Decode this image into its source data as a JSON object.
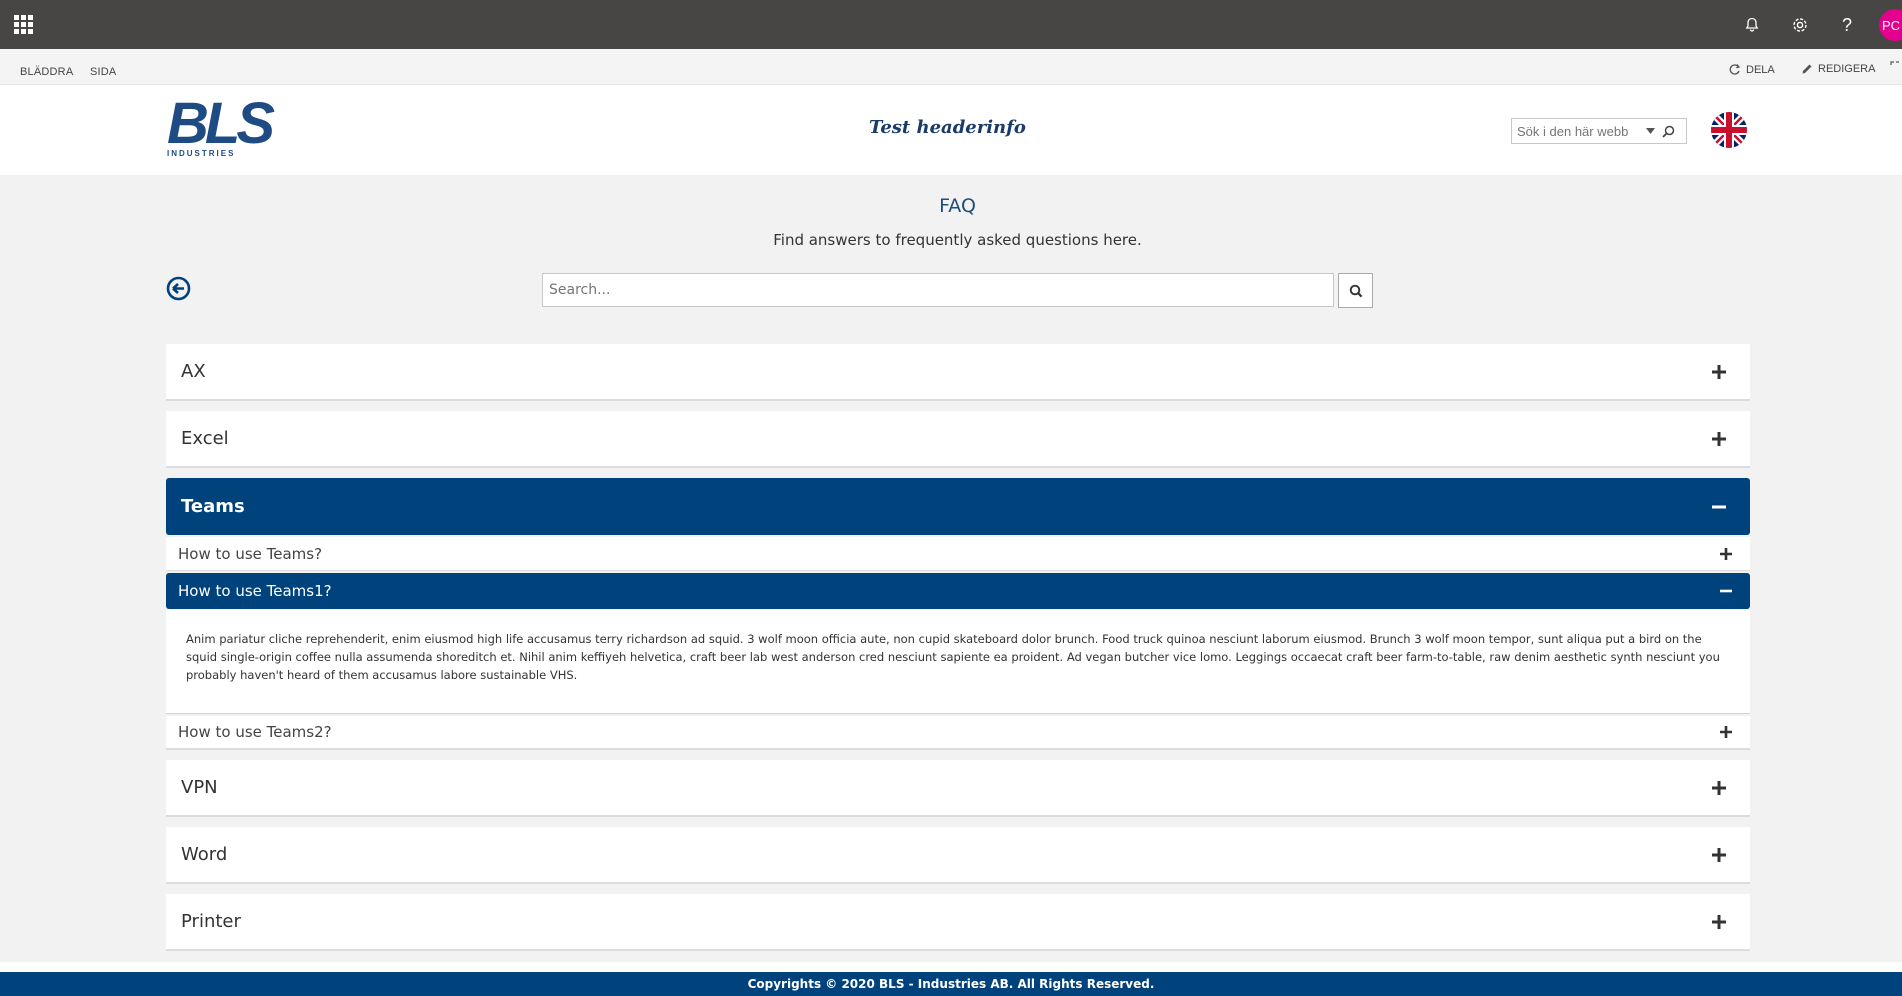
{
  "suitebar": {
    "avatar_initials": "PC"
  },
  "ribbon": {
    "tabs": [
      "BLÄDDRA",
      "SIDA"
    ],
    "share_label": "DELA",
    "edit_label": "REDIGERA"
  },
  "header": {
    "logo_text": "BLS",
    "logo_sub": "INDUSTRIES",
    "headerinfo": "Test headerinfo",
    "site_search_placeholder": "Sök i den här webb"
  },
  "faq": {
    "title": "FAQ",
    "subtitle": "Find answers to frequently asked questions here.",
    "search_placeholder": "Search..."
  },
  "categories": [
    {
      "label": "AX",
      "expanded": false
    },
    {
      "label": "Excel",
      "expanded": false
    },
    {
      "label": "Teams",
      "expanded": true
    },
    {
      "label": "VPN",
      "expanded": false
    },
    {
      "label": "Word",
      "expanded": false
    },
    {
      "label": "Printer",
      "expanded": false
    }
  ],
  "teams_questions": [
    {
      "label": "How to use Teams?",
      "expanded": false
    },
    {
      "label": "How to use Teams1?",
      "expanded": true
    },
    {
      "label": "How to use Teams2?",
      "expanded": false
    }
  ],
  "answer_text": "Anim pariatur cliche reprehenderit, enim eiusmod high life accusamus terry richardson ad squid. 3 wolf moon officia aute, non cupid skateboard dolor brunch. Food truck quinoa nesciunt laborum eiusmod. Brunch 3 wolf moon tempor, sunt aliqua put a bird on the squid single-origin coffee nulla assumenda shoreditch et. Nihil anim keffiyeh helvetica, craft beer lab west anderson cred nesciunt sapiente ea proident. Ad vegan butcher vice lomo. Leggings occaecat craft beer farm-to-table, raw denim aesthetic synth nesciunt you probably haven't heard of them accusamus labore sustainable VHS.",
  "footer": {
    "text": "Copyrights © 2020 BLS - Industries AB. All Rights Reserved."
  },
  "colors": {
    "primary": "#00427c",
    "suitebar": "#474645",
    "avatar": "#e3008c"
  }
}
